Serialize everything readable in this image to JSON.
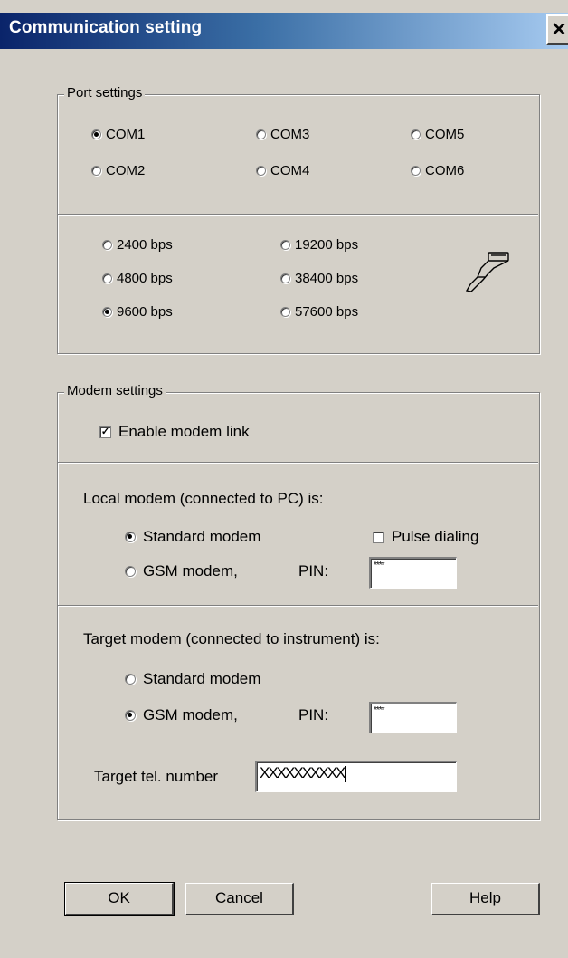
{
  "window": {
    "title": "Communication setting",
    "close_glyph": "✕"
  },
  "port": {
    "legend": "Port settings",
    "com_ports": [
      "COM1",
      "COM2",
      "COM3",
      "COM4",
      "COM5",
      "COM6"
    ],
    "selected_com": "COM1",
    "baud_rates": [
      "2400 bps",
      "4800 bps",
      "9600 bps",
      "19200 bps",
      "38400 bps",
      "57600 bps"
    ],
    "selected_baud": "9600 bps",
    "connector_icon": "serial-cable-icon"
  },
  "modem": {
    "legend": "Modem settings",
    "enable_label": "Enable modem link",
    "enable_checked": true,
    "local": {
      "heading": "Local modem (connected to PC) is:",
      "standard_label": "Standard modem",
      "gsm_label": "GSM modem,",
      "pin_label": "PIN:",
      "pin_value": "****",
      "selected": "standard",
      "pulse_label": "Pulse dialing",
      "pulse_checked": false
    },
    "target": {
      "heading": "Target modem (connected to instrument) is:",
      "standard_label": "Standard modem",
      "gsm_label": "GSM modem,",
      "pin_label": "PIN:",
      "pin_value": "****",
      "selected": "gsm",
      "tel_label": "Target tel. number",
      "tel_value": "XXXXXXXXXX"
    }
  },
  "buttons": {
    "ok": "OK",
    "cancel": "Cancel",
    "help": "Help"
  }
}
